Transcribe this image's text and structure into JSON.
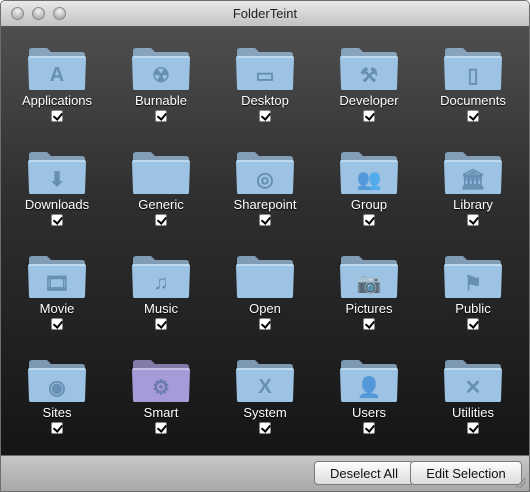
{
  "window": {
    "title": "FolderTeint"
  },
  "folders": [
    {
      "label": "Applications",
      "glyph": "A",
      "icon": "applications-folder-icon",
      "checked": true,
      "tint": "#9cc3e3"
    },
    {
      "label": "Burnable",
      "glyph": "☢",
      "icon": "burnable-folder-icon",
      "checked": true,
      "tint": "#9cc3e3"
    },
    {
      "label": "Desktop",
      "glyph": "▭",
      "icon": "desktop-folder-icon",
      "checked": true,
      "tint": "#9cc3e3"
    },
    {
      "label": "Developer",
      "glyph": "⚒",
      "icon": "developer-folder-icon",
      "checked": true,
      "tint": "#9cc3e3"
    },
    {
      "label": "Documents",
      "glyph": "▯",
      "icon": "documents-folder-icon",
      "checked": true,
      "tint": "#9cc3e3"
    },
    {
      "label": "Downloads",
      "glyph": "⬇",
      "icon": "downloads-folder-icon",
      "checked": true,
      "tint": "#9cc3e3"
    },
    {
      "label": "Generic",
      "glyph": "",
      "icon": "generic-folder-icon",
      "checked": true,
      "tint": "#9cc3e3"
    },
    {
      "label": "Sharepoint",
      "glyph": "◎",
      "icon": "sharepoint-folder-icon",
      "checked": true,
      "tint": "#9cc3e3"
    },
    {
      "label": "Group",
      "glyph": "👥",
      "icon": "group-folder-icon",
      "checked": true,
      "tint": "#9cc3e3"
    },
    {
      "label": "Library",
      "glyph": "🏛",
      "icon": "library-folder-icon",
      "checked": true,
      "tint": "#9cc3e3"
    },
    {
      "label": "Movie",
      "glyph": "🎞",
      "icon": "movie-folder-icon",
      "checked": true,
      "tint": "#9cc3e3"
    },
    {
      "label": "Music",
      "glyph": "♫",
      "icon": "music-folder-icon",
      "checked": true,
      "tint": "#9cc3e3"
    },
    {
      "label": "Open",
      "glyph": "",
      "icon": "open-folder-icon",
      "checked": true,
      "tint": "#9cc3e3"
    },
    {
      "label": "Pictures",
      "glyph": "📷",
      "icon": "pictures-folder-icon",
      "checked": true,
      "tint": "#9cc3e3"
    },
    {
      "label": "Public",
      "glyph": "⚑",
      "icon": "public-folder-icon",
      "checked": true,
      "tint": "#9cc3e3"
    },
    {
      "label": "Sites",
      "glyph": "◉",
      "icon": "sites-folder-icon",
      "checked": true,
      "tint": "#9cc3e3"
    },
    {
      "label": "Smart",
      "glyph": "⚙",
      "icon": "smart-folder-icon",
      "checked": true,
      "tint": "#a79ad8"
    },
    {
      "label": "System",
      "glyph": "X",
      "icon": "system-folder-icon",
      "checked": true,
      "tint": "#9cc3e3"
    },
    {
      "label": "Users",
      "glyph": "👤",
      "icon": "users-folder-icon",
      "checked": true,
      "tint": "#9cc3e3"
    },
    {
      "label": "Utilities",
      "glyph": "✕",
      "icon": "utilities-folder-icon",
      "checked": true,
      "tint": "#9cc3e3"
    }
  ],
  "buttons": {
    "deselect_all": "Deselect All",
    "edit_selection": "Edit Selection"
  }
}
